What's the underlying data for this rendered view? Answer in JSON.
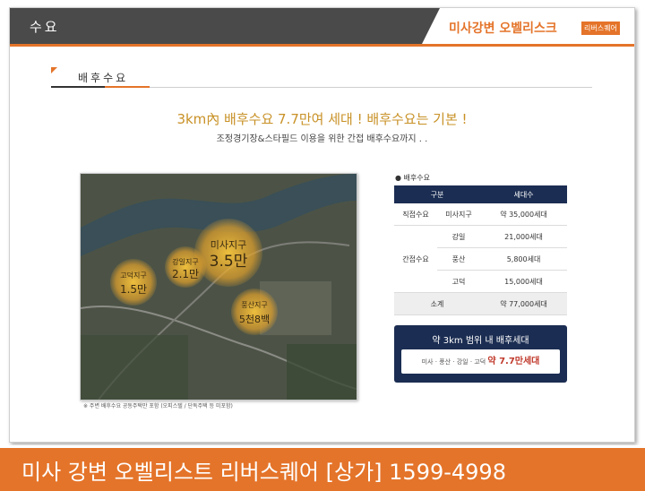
{
  "header": {
    "section": "수요",
    "brand": "미사강변 오벨리스크",
    "brand_tag": "리버스퀘어"
  },
  "tab": {
    "label": "배후수요"
  },
  "headline": {
    "title": "3km內 배후수요 7.7만여 세대 ! 배후수요는 기본 !",
    "subtitle": "조정경기장&스타필드 이용을 위한 간접 배후수요까지 . ."
  },
  "map": {
    "areas": [
      {
        "name": "미사지구",
        "value": "3.5만"
      },
      {
        "name": "강일지구",
        "value": "2.1만"
      },
      {
        "name": "고덕지구",
        "value": "1.5만"
      },
      {
        "name": "풍산지구",
        "value": "5천8백"
      }
    ],
    "note": "※ 주변 배후수요 공동주택만 포함 (오피스텔 / 단독주택 등 미포함)"
  },
  "demand_panel": {
    "title": "● 배후수요",
    "headers": [
      "구분",
      "세대수"
    ],
    "rows": [
      {
        "group": "직접수요",
        "area": "미사지구",
        "count": "약 35,000세대"
      },
      {
        "group": "간접수요",
        "area": "강일",
        "count": "21,000세대"
      },
      {
        "group": "",
        "area": "풍산",
        "count": "5,800세대"
      },
      {
        "group": "",
        "area": "고덕",
        "count": "15,000세대"
      }
    ],
    "total": {
      "label": "소계",
      "count": "약 77,000세대"
    }
  },
  "summary": {
    "title": "약 3km 범위 내 배후세대",
    "detail": "미사 · 풍산 · 강일 · 고덕",
    "highlight": "약 7.7만세대"
  },
  "banner": {
    "text": "미사 강변 오벨리스트 리버스퀘어 [상가]   1599-4998"
  },
  "colors": {
    "accent": "#e4742a",
    "navy": "#1b2d52",
    "gold": "#c89126"
  }
}
